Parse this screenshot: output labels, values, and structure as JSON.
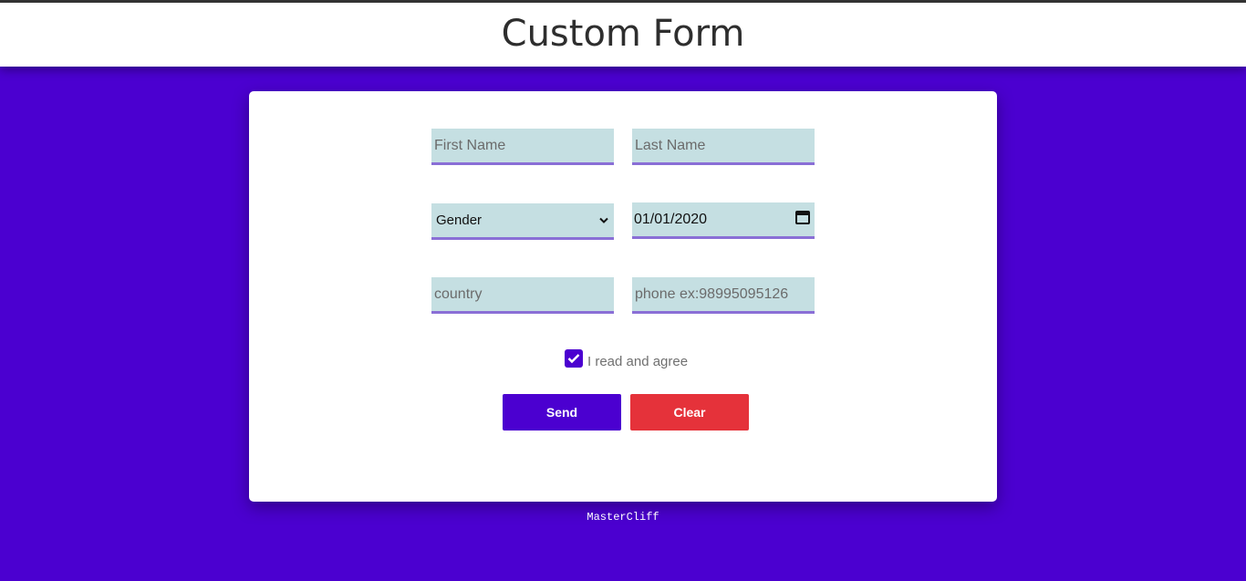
{
  "header": {
    "title": "Custom Form"
  },
  "form": {
    "first_name": {
      "placeholder": "First Name",
      "value": ""
    },
    "last_name": {
      "placeholder": "Last Name",
      "value": ""
    },
    "gender": {
      "selected": "Gender",
      "icon": "chevron-down-icon"
    },
    "birthdate": {
      "value": "01/01/2020",
      "icon": "calendar-icon"
    },
    "country": {
      "placeholder": "country",
      "value": ""
    },
    "phone": {
      "placeholder": "phone ex:98995095126",
      "value": ""
    },
    "agree": {
      "label": "I read and agree",
      "checked": true
    },
    "send_label": "Send",
    "clear_label": "Clear"
  },
  "footer": {
    "text": "MasterCliff"
  },
  "colors": {
    "background": "#4b00d0",
    "field_bg": "#c5dfe2",
    "field_underline": "#8a6fd6",
    "send": "#4b00d0",
    "clear": "#e5323a"
  }
}
